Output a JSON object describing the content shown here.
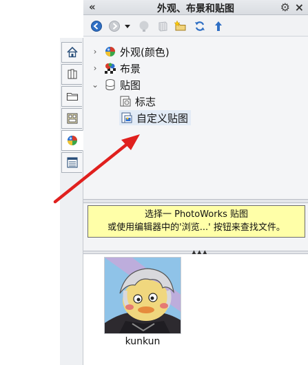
{
  "panel": {
    "title": "外观、布景和贴图",
    "collapse_glyph": "«",
    "gear_glyph": "⚙",
    "close_glyph": "×"
  },
  "toolbar": {
    "buttons": [
      {
        "name": "back-icon"
      },
      {
        "name": "forward-icon"
      },
      {
        "name": "dropdown-icon"
      },
      {
        "name": "appearance-ball-icon"
      },
      {
        "name": "part-icon"
      },
      {
        "name": "new-folder-icon"
      },
      {
        "name": "refresh-icon"
      },
      {
        "name": "up-folder-icon"
      }
    ]
  },
  "tree": {
    "items": [
      {
        "label": "外观(颜色)",
        "expander": "›"
      },
      {
        "label": "布景",
        "expander": "›"
      },
      {
        "label": "贴图",
        "expander": "⌄"
      },
      {
        "label": "标志"
      },
      {
        "label": "自定义贴图"
      }
    ]
  },
  "hint": {
    "line1": "选择一 PhotoWorks 贴图",
    "line2": "或使用编辑器中的'浏览...' 按钮来查找文件。"
  },
  "gallery": {
    "items": [
      {
        "caption": "kunkun"
      }
    ]
  },
  "colors": {
    "arrow": "#e0201e",
    "selection": "#e2ebf6",
    "hint_bg": "#ffffa8"
  }
}
